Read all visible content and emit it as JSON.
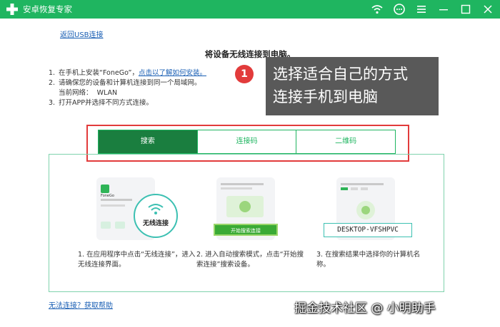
{
  "app": {
    "title": "安卓恢复专家",
    "brand_color": "#1fb560"
  },
  "window_icons": [
    "wifi-icon",
    "feedback-icon",
    "menu-icon",
    "minimize-icon",
    "maximize-icon",
    "close-icon"
  ],
  "nav": {
    "back_link": "返回USB连接"
  },
  "main": {
    "heading": "将设备无线连接到电脑。",
    "steps": {
      "s1_num": "1.",
      "s1_text": "在手机上安装“FoneGo”，",
      "s1_link": "点击以了解如何安装。",
      "s2_num": "2.",
      "s2_text": "请确保您的设备和计算机连接到同一个局域网。",
      "s2_network_label": "当前网络：",
      "s2_network_value": "WLAN",
      "s3_num": "3.",
      "s3_text": "打开APP并选择不同方式连接。"
    },
    "tabs": [
      {
        "label": "搜索",
        "active": true
      },
      {
        "label": "连接码",
        "active": false
      },
      {
        "label": "二维码",
        "active": false
      }
    ],
    "cards": {
      "c1_app_name": "FoneGo",
      "c1_badge": "无线连接",
      "c1_desc": "1.  在应用程序中点击“无线连接”，进入无线连接界面。",
      "c2_button": "开始搜索连接",
      "c2_desc": "2.  进入自动搜索模式，点击“开始搜索连接”搜索设备。",
      "c3_device": "DESKTOP-VFSHPVC",
      "c3_desc": "3.  在搜索结果中选择你的计算机名称。"
    },
    "help_link": "无法连接？获取帮助"
  },
  "callout": {
    "number": "1",
    "line1": "选择适合自己的方式",
    "line2": "连接手机到电脑"
  },
  "watermark": "掘金技术社区 @ 小明助手"
}
